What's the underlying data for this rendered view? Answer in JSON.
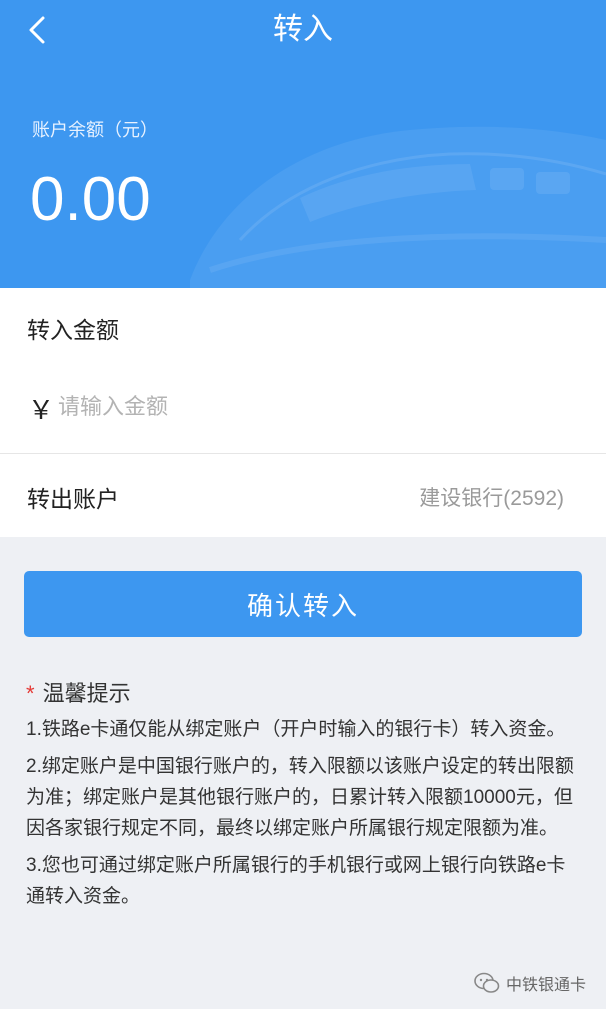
{
  "header": {
    "title": "转入",
    "balance_label": "账户余额（元）",
    "balance_value": "0.00",
    "color": "#3d97f0"
  },
  "form": {
    "amount_label": "转入金额",
    "currency_symbol": "￥",
    "amount_placeholder": "请输入金额",
    "amount_value": "",
    "account_label": "转出账户",
    "account_value": "建设银行(2592)"
  },
  "confirm_button": {
    "label": "确认转入"
  },
  "tips": {
    "star": "*",
    "title": "温馨提示",
    "items": [
      "1.铁路e卡通仅能从绑定账户（开户时输入的银行卡）转入资金。",
      "2.绑定账户是中国银行账户的，转入限额以该账户设定的转出限额为准；绑定账户是其他银行账户的，日累计转入限额10000元，但因各家银行规定不同，最终以绑定账户所属银行规定限额为准。",
      "3.您也可通过绑定账户所属银行的手机银行或网上银行向铁路e卡通转入资金。"
    ]
  },
  "watermark": {
    "text": "中铁银通卡",
    "icon": "wechat-icon"
  }
}
